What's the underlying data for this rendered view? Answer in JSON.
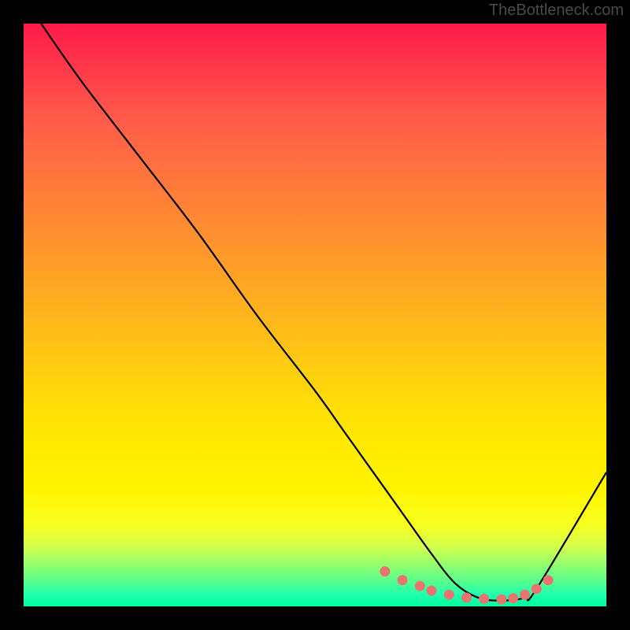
{
  "watermark": "TheBottleneck.com",
  "chart_data": {
    "type": "line",
    "title": "",
    "xlabel": "",
    "ylabel": "",
    "xlim": [
      0,
      100
    ],
    "ylim": [
      0,
      100
    ],
    "x": [
      3,
      10,
      20,
      30,
      40,
      50,
      55,
      60,
      65,
      70,
      74,
      78,
      82,
      86,
      88,
      100
    ],
    "values": [
      100,
      90,
      77,
      64,
      50,
      37,
      30,
      23,
      16,
      9,
      4,
      1.5,
      1,
      1.5,
      3,
      23
    ],
    "marker_region": {
      "x": [
        62,
        65,
        68,
        70,
        73,
        76,
        79,
        82,
        84,
        86,
        88,
        90
      ],
      "y": [
        6,
        4.5,
        3.5,
        2.7,
        2,
        1.5,
        1.3,
        1.2,
        1.4,
        2,
        3,
        4.5
      ]
    },
    "marker_color": "#e8736f",
    "line_color": "#000000",
    "gradient_stops": [
      {
        "pos": 0,
        "color": "#ff1a4a"
      },
      {
        "pos": 50,
        "color": "#ffba1a"
      },
      {
        "pos": 85,
        "color": "#f8ff20"
      },
      {
        "pos": 100,
        "color": "#00ff9a"
      }
    ]
  }
}
